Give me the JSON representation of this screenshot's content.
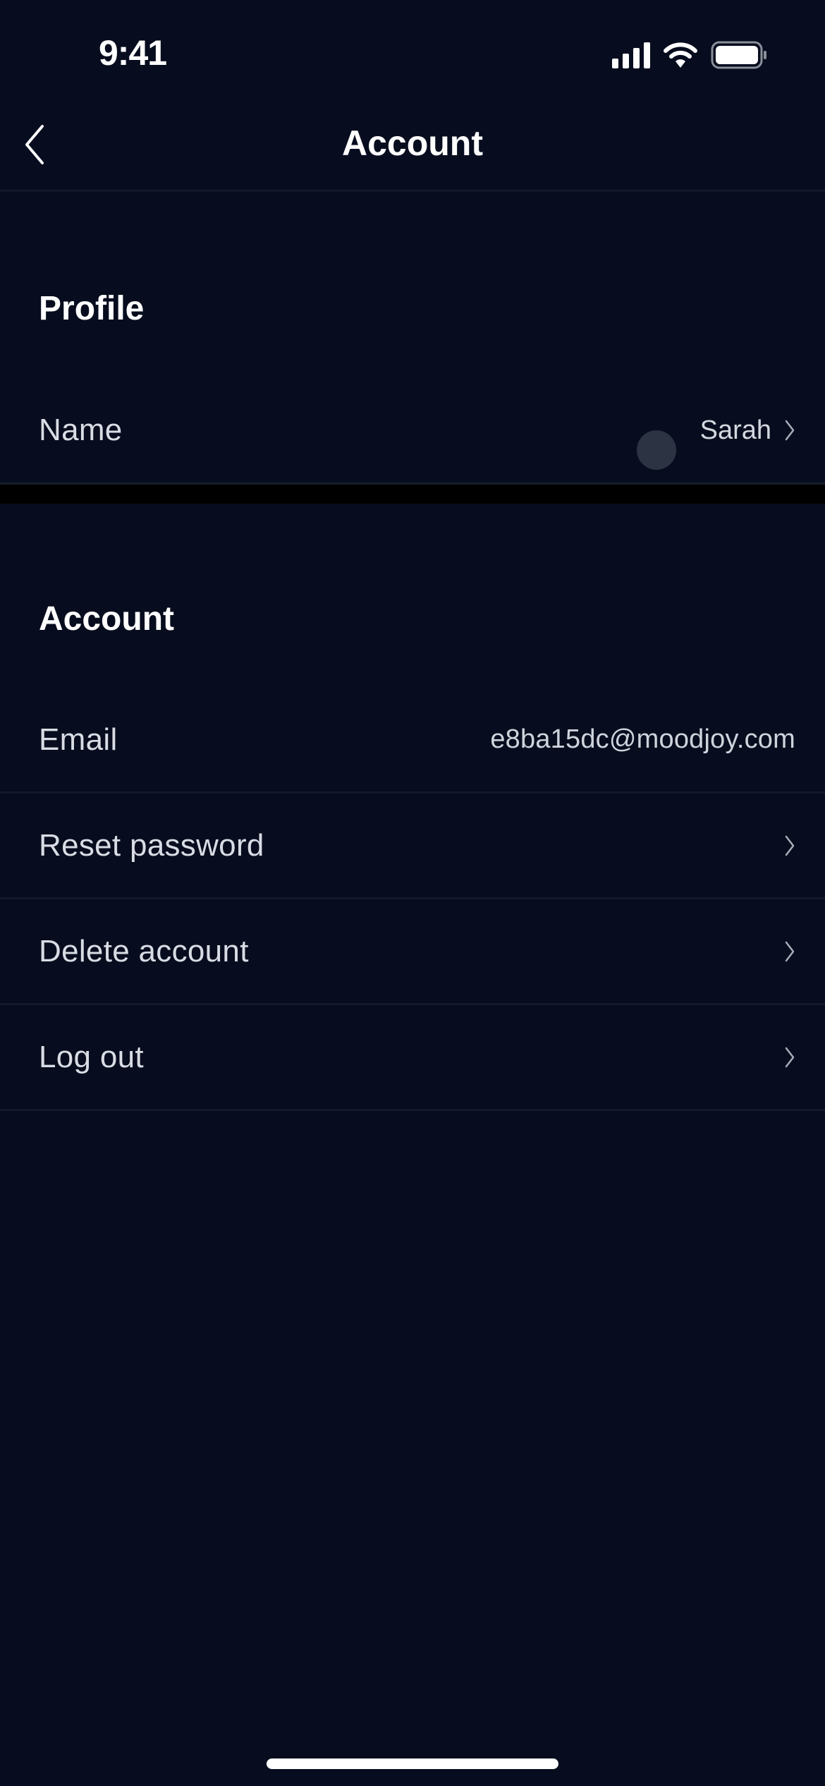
{
  "status_bar": {
    "time": "9:41",
    "icons": [
      "cellular-signal-icon",
      "wifi-icon",
      "battery-icon"
    ]
  },
  "nav": {
    "back_icon": "chevron-left-icon",
    "title": "Account"
  },
  "sections": {
    "profile": {
      "header": "Profile",
      "rows": [
        {
          "label": "Name",
          "value": "Sarah",
          "chevron": true
        }
      ]
    },
    "account": {
      "header": "Account",
      "rows": [
        {
          "label": "Email",
          "value": "e8ba15dc@moodjoy.com",
          "chevron": false
        },
        {
          "label": "Reset password",
          "value": "",
          "chevron": true
        },
        {
          "label": "Delete account",
          "value": "",
          "chevron": true
        },
        {
          "label": "Log out",
          "value": "",
          "chevron": true
        }
      ]
    }
  },
  "colors": {
    "background": "#070d1e",
    "divider": "#121a2b",
    "section_gap": "#000000",
    "text_primary": "#ffffff",
    "text_secondary": "#d9dce4"
  }
}
